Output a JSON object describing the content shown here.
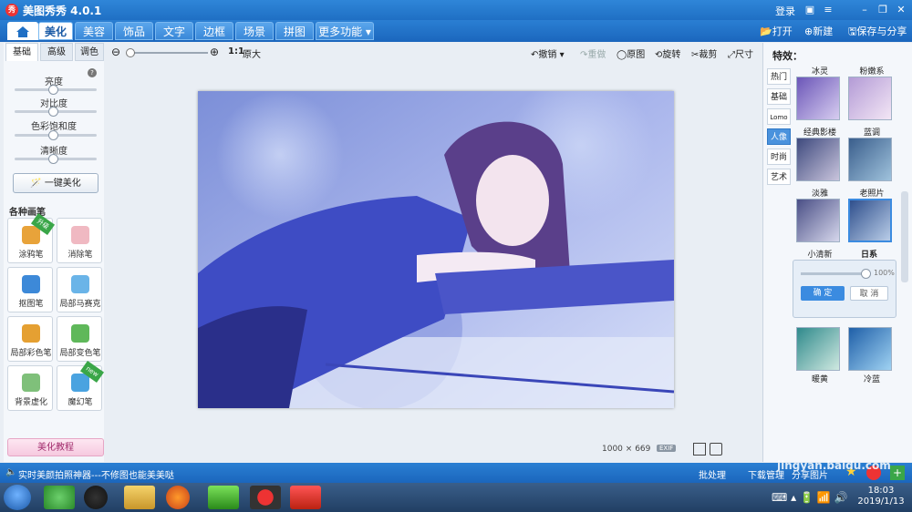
{
  "titlebar": {
    "title": "美图秀秀 4.0.1",
    "login": "登录"
  },
  "menubar": {
    "tabs": [
      "美化",
      "美容",
      "饰品",
      "文字",
      "边框",
      "场景",
      "拼图",
      "更多功能"
    ],
    "actions": {
      "open": "打开",
      "new": "新建",
      "save_share": "保存与分享"
    }
  },
  "leftpanel": {
    "tabs": [
      "基础",
      "高级",
      "调色"
    ],
    "sliders": [
      {
        "label": "亮度",
        "level": 0.45
      },
      {
        "label": "对比度",
        "level": 0.45
      },
      {
        "label": "色彩饱和度",
        "level": 0.45
      },
      {
        "label": "清晰度",
        "level": 0.45
      }
    ],
    "one_key": "一键美化",
    "brushes_header": "各种画笔",
    "brushes": [
      {
        "label": "涂鸦笔",
        "badge": "升级",
        "color": "#e8a33a"
      },
      {
        "label": "消除笔",
        "badge": "",
        "color": "#f0b9c2"
      },
      {
        "label": "抠图笔",
        "badge": "",
        "color": "#3d89d8"
      },
      {
        "label": "局部马赛克",
        "badge": "",
        "color": "#6ab4e8"
      },
      {
        "label": "局部彩色笔",
        "badge": "",
        "color": "#e5a032"
      },
      {
        "label": "局部变色笔",
        "badge": "",
        "color": "#5fb85a"
      },
      {
        "label": "背景虚化",
        "badge": "",
        "color": "#7fc07a"
      },
      {
        "label": "魔幻笔",
        "badge": "new",
        "color": "#4aa3e0"
      }
    ],
    "tutorial": "美化教程"
  },
  "toolbar": {
    "zoom_ratio": "1:1",
    "zoom_orig": "原大",
    "undo": "撤销",
    "redo": "重做",
    "original": "原图",
    "rotate": "旋转",
    "crop": "裁剪",
    "size": "尺寸"
  },
  "image": {
    "width": "1000",
    "x": "×",
    "height": "669",
    "exif": "EXIF"
  },
  "rightpanel": {
    "title": "特效：",
    "categories": [
      "热门",
      "基础",
      "Lomo",
      "人像",
      "时尚",
      "艺术"
    ],
    "active_category": "人像",
    "effects": [
      "冰灵",
      "粉嫩系",
      "经典影楼",
      "蓝调",
      "淡雅",
      "老照片",
      "小清新",
      "日系",
      "暖黄",
      "冷蓝"
    ],
    "selected_effect": "日系",
    "opacity_label": "100%",
    "opacity_level": 1.0,
    "ok": "确 定",
    "cancel": "取 消"
  },
  "statusbar": {
    "message": "实时美颜拍照神器---不修图也能美美哒",
    "batch": "批处理",
    "download": "下载管理",
    "share": "分享图片"
  },
  "taskbar": {
    "time": "18:03",
    "date": "2019/1/13"
  },
  "watermark": "jingyan.baidu.com",
  "colors": {
    "accent": "#1f6fc4",
    "selected": "#3b8be0"
  }
}
